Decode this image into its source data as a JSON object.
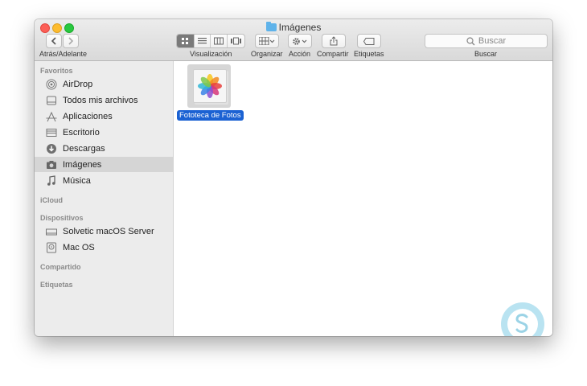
{
  "window": {
    "title": "Imágenes"
  },
  "toolbar": {
    "nav_label": "Atrás/Adelante",
    "view_label": "Visualización",
    "arrange_label": "Organizar",
    "action_label": "Acción",
    "share_label": "Compartir",
    "tags_label": "Etiquetas",
    "search_label": "Buscar",
    "search_placeholder": "Buscar",
    "active_view": "icon"
  },
  "sidebar": {
    "sections": [
      {
        "title": "Favoritos",
        "items": [
          {
            "label": "AirDrop",
            "icon": "airdrop-icon"
          },
          {
            "label": "Todos mis archivos",
            "icon": "all-files-icon"
          },
          {
            "label": "Aplicaciones",
            "icon": "applications-icon"
          },
          {
            "label": "Escritorio",
            "icon": "desktop-icon"
          },
          {
            "label": "Descargas",
            "icon": "downloads-icon"
          },
          {
            "label": "Imágenes",
            "icon": "camera-icon",
            "selected": true
          },
          {
            "label": "Música",
            "icon": "music-note-icon"
          }
        ]
      },
      {
        "title": "iCloud",
        "items": []
      },
      {
        "title": "Dispositivos",
        "items": [
          {
            "label": "Solvetic macOS Server",
            "icon": "computer-icon"
          },
          {
            "label": "Mac OS",
            "icon": "hard-disk-icon"
          }
        ]
      },
      {
        "title": "Compartido",
        "items": []
      },
      {
        "title": "Etiquetas",
        "items": []
      }
    ]
  },
  "content": {
    "files": [
      {
        "name": "Fototeca de Fotos",
        "icon": "photos-library-icon",
        "selected": true
      }
    ]
  },
  "colors": {
    "selection": "#1b62d3",
    "sidebar_bg": "#ececec",
    "close": "#fc5f57",
    "minimize": "#fdbc2e",
    "maximize": "#28c840"
  }
}
